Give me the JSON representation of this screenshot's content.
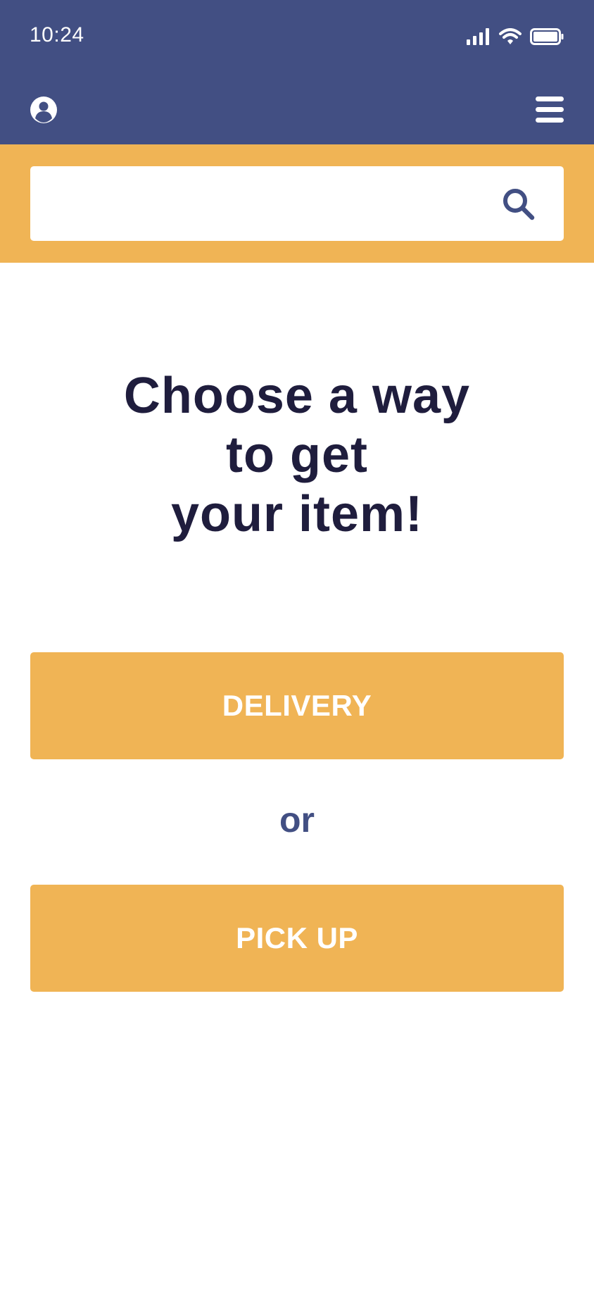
{
  "status_bar": {
    "time": "10:24",
    "icons": [
      "signal-icon",
      "wifi-icon",
      "battery-icon"
    ]
  },
  "header": {
    "left_icon": "profile-icon",
    "right_icon": "menu-icon"
  },
  "search": {
    "value": "",
    "placeholder": "",
    "icon": "search-icon"
  },
  "main": {
    "headline_lines": [
      "Choose a way",
      "to get",
      "your item!"
    ],
    "delivery_label": "DELIVERY",
    "or_label": "or",
    "pickup_label": "PICK UP"
  },
  "colors": {
    "header_bg": "#424f83",
    "accent": "#f0b455",
    "headline_text": "#1f1d3d",
    "or_text": "#424f83",
    "button_text": "#ffffff"
  }
}
